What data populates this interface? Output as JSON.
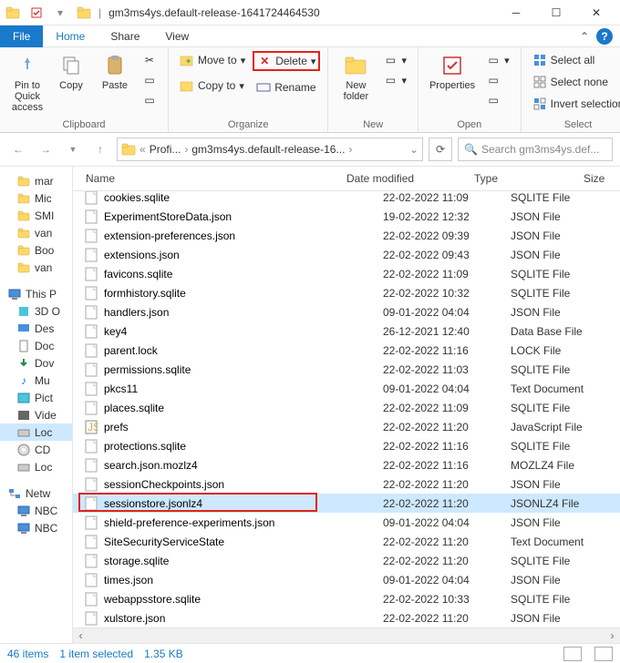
{
  "window": {
    "title": "gm3ms4ys.default-release-1641724464530"
  },
  "menubar": {
    "file": "File",
    "tabs": [
      "Home",
      "Share",
      "View"
    ],
    "active_tab": "Home"
  },
  "ribbon": {
    "clipboard": {
      "label": "Clipboard",
      "pin": "Pin to Quick access",
      "copy": "Copy",
      "paste": "Paste"
    },
    "organize": {
      "label": "Organize",
      "move_to": "Move to",
      "copy_to": "Copy to",
      "delete": "Delete",
      "rename": "Rename"
    },
    "new": {
      "label": "New",
      "new_folder": "New folder"
    },
    "open": {
      "label": "Open",
      "properties": "Properties"
    },
    "select": {
      "label": "Select",
      "select_all": "Select all",
      "select_none": "Select none",
      "invert": "Invert selection"
    }
  },
  "breadcrumbs": [
    "Profi...",
    "gm3ms4ys.default-release-16..."
  ],
  "search_placeholder": "Search gm3ms4ys.def...",
  "nav_tree": [
    {
      "label": "mar",
      "type": "folder",
      "indent": 1
    },
    {
      "label": "Mic",
      "type": "folder",
      "indent": 1
    },
    {
      "label": "SMI",
      "type": "folder",
      "indent": 1
    },
    {
      "label": "van",
      "type": "folder",
      "indent": 1
    },
    {
      "label": "Boo",
      "type": "folder",
      "indent": 1
    },
    {
      "label": "van",
      "type": "folder",
      "indent": 1
    },
    {
      "label": "",
      "type": "spacer"
    },
    {
      "label": "This P",
      "type": "pc",
      "indent": 0
    },
    {
      "label": "3D O",
      "type": "3d",
      "indent": 1
    },
    {
      "label": "Des",
      "type": "desktop",
      "indent": 1
    },
    {
      "label": "Doc",
      "type": "docs",
      "indent": 1
    },
    {
      "label": "Dov",
      "type": "downloads",
      "indent": 1
    },
    {
      "label": "Mu",
      "type": "music",
      "indent": 1
    },
    {
      "label": "Pict",
      "type": "pictures",
      "indent": 1
    },
    {
      "label": "Vide",
      "type": "videos",
      "indent": 1
    },
    {
      "label": "Loc",
      "type": "disk",
      "indent": 1,
      "selected": true
    },
    {
      "label": "CD",
      "type": "cd",
      "indent": 1
    },
    {
      "label": "Loc",
      "type": "disk",
      "indent": 1
    },
    {
      "label": "",
      "type": "spacer"
    },
    {
      "label": "Netw",
      "type": "network",
      "indent": 0
    },
    {
      "label": "NBC",
      "type": "pc",
      "indent": 1
    },
    {
      "label": "NBC",
      "type": "pc",
      "indent": 1
    }
  ],
  "columns": {
    "name": "Name",
    "date": "Date modified",
    "type": "Type",
    "size": "Size"
  },
  "files": [
    {
      "name": "cookies.sqlite",
      "date": "22-02-2022 11:09",
      "type": "SQLITE File"
    },
    {
      "name": "ExperimentStoreData.json",
      "date": "19-02-2022 12:32",
      "type": "JSON File"
    },
    {
      "name": "extension-preferences.json",
      "date": "22-02-2022 09:39",
      "type": "JSON File"
    },
    {
      "name": "extensions.json",
      "date": "22-02-2022 09:43",
      "type": "JSON File"
    },
    {
      "name": "favicons.sqlite",
      "date": "22-02-2022 11:09",
      "type": "SQLITE File"
    },
    {
      "name": "formhistory.sqlite",
      "date": "22-02-2022 10:32",
      "type": "SQLITE File"
    },
    {
      "name": "handlers.json",
      "date": "09-01-2022 04:04",
      "type": "JSON File"
    },
    {
      "name": "key4",
      "date": "26-12-2021 12:40",
      "type": "Data Base File"
    },
    {
      "name": "parent.lock",
      "date": "22-02-2022 11:16",
      "type": "LOCK File"
    },
    {
      "name": "permissions.sqlite",
      "date": "22-02-2022 11:03",
      "type": "SQLITE File"
    },
    {
      "name": "pkcs11",
      "date": "09-01-2022 04:04",
      "type": "Text Document"
    },
    {
      "name": "places.sqlite",
      "date": "22-02-2022 11:09",
      "type": "SQLITE File"
    },
    {
      "name": "prefs",
      "date": "22-02-2022 11:20",
      "type": "JavaScript File",
      "jsicon": true
    },
    {
      "name": "protections.sqlite",
      "date": "22-02-2022 11:16",
      "type": "SQLITE File"
    },
    {
      "name": "search.json.mozlz4",
      "date": "22-02-2022 11:16",
      "type": "MOZLZ4 File"
    },
    {
      "name": "sessionCheckpoints.json",
      "date": "22-02-2022 11:20",
      "type": "JSON File"
    },
    {
      "name": "sessionstore.jsonlz4",
      "date": "22-02-2022 11:20",
      "type": "JSONLZ4 File",
      "selected": true,
      "highlighted": true
    },
    {
      "name": "shield-preference-experiments.json",
      "date": "09-01-2022 04:04",
      "type": "JSON File"
    },
    {
      "name": "SiteSecurityServiceState",
      "date": "22-02-2022 11:20",
      "type": "Text Document"
    },
    {
      "name": "storage.sqlite",
      "date": "22-02-2022 11:20",
      "type": "SQLITE File"
    },
    {
      "name": "times.json",
      "date": "09-01-2022 04:04",
      "type": "JSON File"
    },
    {
      "name": "webappsstore.sqlite",
      "date": "22-02-2022 10:33",
      "type": "SQLITE File"
    },
    {
      "name": "xulstore.json",
      "date": "22-02-2022 11:20",
      "type": "JSON File"
    }
  ],
  "status": {
    "items": "46 items",
    "selected": "1 item selected",
    "size": "1.35 KB"
  }
}
